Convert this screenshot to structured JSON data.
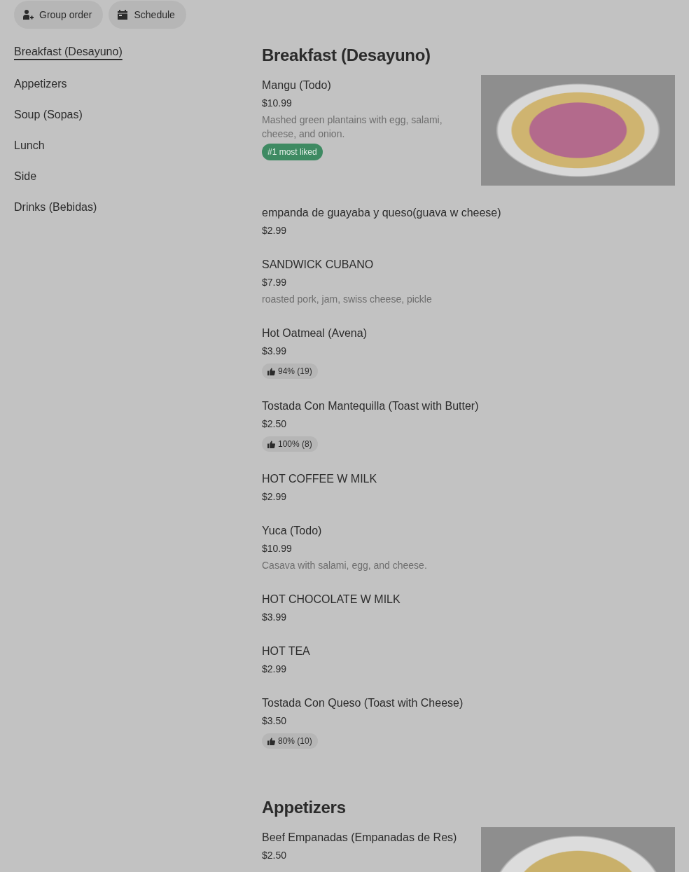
{
  "top_buttons": [
    {
      "label": "Group order",
      "kind": "group"
    },
    {
      "label": "Schedule",
      "kind": "calendar"
    }
  ],
  "sidebar": {
    "items": [
      {
        "label": "Breakfast (Desayuno)",
        "selected": true
      },
      {
        "label": "Appetizers",
        "selected": false
      },
      {
        "label": "Soup (Sopas)",
        "selected": false
      },
      {
        "label": "Lunch",
        "selected": false
      },
      {
        "label": "Side",
        "selected": false
      },
      {
        "label": "Drinks (Bebidas)",
        "selected": false
      }
    ]
  },
  "sections": [
    {
      "title": "Breakfast (Desayuno)",
      "items": [
        {
          "name": "Mangu (Todo)",
          "price": "$10.99",
          "description": "Mashed green plantains with egg, salami, cheese, and onion.",
          "badge": {
            "kind": "liked",
            "text": "#1 most liked"
          },
          "photo": true
        },
        {
          "name": "empanda de guayaba y queso(guava w cheese)",
          "price": "$2.99"
        },
        {
          "name": "SANDWICK CUBANO",
          "price": "$7.99",
          "description": "roasted pork, jam, swiss cheese, pickle"
        },
        {
          "name": "Hot Oatmeal (Avena)",
          "price": "$3.99",
          "badge": {
            "kind": "rating",
            "text": "94% (19)"
          }
        },
        {
          "name": "Tostada Con Mantequilla (Toast with Butter)",
          "price": "$2.50",
          "badge": {
            "kind": "rating",
            "text": "100% (8)"
          }
        },
        {
          "name": "HOT COFFEE W MILK",
          "price": "$2.99"
        },
        {
          "name": "Yuca (Todo)",
          "price": "$10.99",
          "description": "Casava with salami, egg, and cheese."
        },
        {
          "name": "HOT CHOCOLATE W MILK",
          "price": "$3.99"
        },
        {
          "name": "HOT TEA",
          "price": "$2.99"
        },
        {
          "name": "Tostada Con Queso (Toast with Cheese)",
          "price": "$3.50",
          "badge": {
            "kind": "rating",
            "text": "80% (10)"
          }
        }
      ]
    },
    {
      "title": "Appetizers",
      "items": [
        {
          "name": "Beef Empanadas (Empanadas de Res)",
          "price": "$2.50",
          "photo": true
        }
      ]
    }
  ]
}
